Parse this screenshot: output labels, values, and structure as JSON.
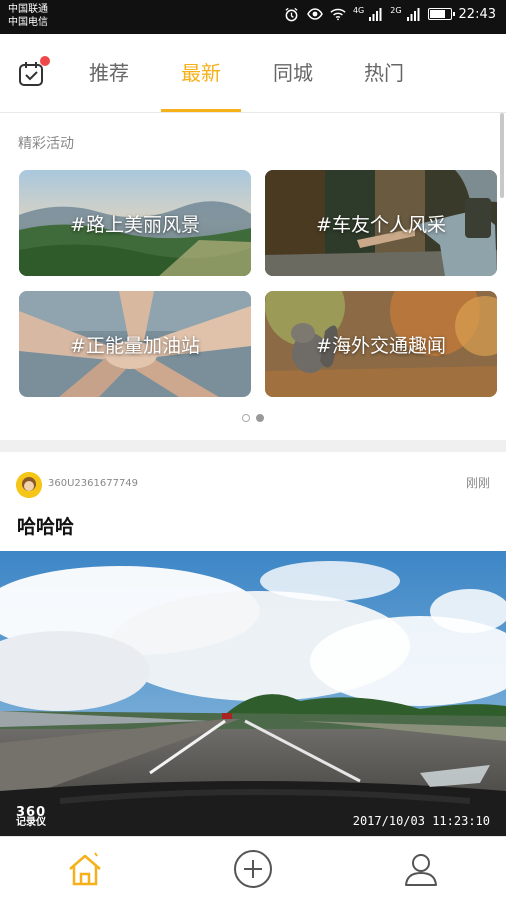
{
  "status_bar": {
    "carrier_1": "中国联通",
    "carrier_2": "中国电信",
    "network_1": "4G",
    "network_2": "2G",
    "time": "22:43",
    "battery_level": 0.7,
    "icons": [
      "alarm-icon",
      "eye-icon",
      "wifi-icon",
      "signal-icon",
      "signal-icon",
      "battery-icon"
    ]
  },
  "header": {
    "calendar_icon": "calendar-check-icon",
    "notification_dot_color": "#f04848",
    "tabs": [
      {
        "label": "推荐",
        "active": false
      },
      {
        "label": "最新",
        "active": true
      },
      {
        "label": "同城",
        "active": false
      },
      {
        "label": "热门",
        "active": false
      }
    ],
    "accent_color": "#f5b01a"
  },
  "activities": {
    "title": "精彩活动",
    "cards": [
      {
        "label": "#路上美丽风景"
      },
      {
        "label": "#车友个人风采"
      },
      {
        "label": "#正能量加油站"
      },
      {
        "label": "#海外交通趣闻"
      }
    ],
    "pager": {
      "total": 2,
      "current": 2
    }
  },
  "post": {
    "username": "360U2361677749",
    "time": "刚刚",
    "title": "哈哈哈",
    "photo_brand_line1": "360",
    "photo_brand_line2": "记录仪",
    "photo_timestamp": "2017/10/03  11:23:10"
  },
  "bottom_nav": {
    "items": [
      {
        "icon": "home-icon",
        "active": true
      },
      {
        "icon": "add-circle-icon",
        "active": false
      },
      {
        "icon": "profile-icon",
        "active": false
      }
    ]
  }
}
